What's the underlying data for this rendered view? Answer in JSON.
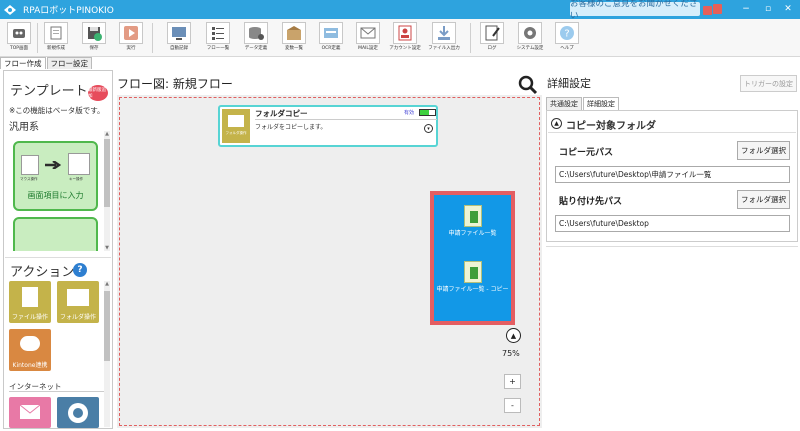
{
  "window": {
    "title": "RPAロボットPINOKIO",
    "feedback": "お客様のご意見をお聞かせください",
    "minimize": "−",
    "restore": "▫",
    "close": "✕"
  },
  "toolbar": {
    "items": [
      {
        "label": "TOP画面",
        "icon": "robot-icon"
      },
      {
        "label": "新規作成",
        "icon": "new-flow-icon"
      },
      {
        "label": "保存",
        "icon": "save-icon"
      },
      {
        "label": "実行",
        "icon": "play-icon"
      },
      {
        "label": "自動記録",
        "icon": "record-icon"
      },
      {
        "label": "フロー一覧",
        "icon": "flow-list-icon"
      },
      {
        "label": "データ定義",
        "icon": "data-definition-icon"
      },
      {
        "label": "変数一覧",
        "icon": "variable-list-icon"
      },
      {
        "label": "OCR定義",
        "icon": "ocr-icon"
      },
      {
        "label": "MAIL設定",
        "icon": "mail-settings-icon"
      },
      {
        "label": "アカウント設定",
        "icon": "account-icon"
      },
      {
        "label": "ファイル入出力",
        "icon": "file-io-icon"
      },
      {
        "label": "ログ",
        "icon": "log-icon"
      },
      {
        "label": "システム設定",
        "icon": "gear-icon"
      },
      {
        "label": "ヘルプ",
        "icon": "help-icon"
      }
    ]
  },
  "tabs": [
    "フロー作成",
    "フロー設定"
  ],
  "templates": {
    "title": "テンプレート",
    "badge": "最新版追加",
    "note": "※この機能はベータ版です。",
    "category": "汎用系",
    "card1": {
      "label": "画面項目に入力",
      "mini1": "マウス操作",
      "mini2": "キー操作"
    }
  },
  "actions": {
    "title": "アクション",
    "help": "?",
    "tiles": [
      {
        "label": "ファイル操作",
        "color": "#c4b34a"
      },
      {
        "label": "フォルダ操作",
        "color": "#c4b34a"
      },
      {
        "label": "Kintone連携",
        "color": "#d98841"
      }
    ],
    "category_internet": "インターネット"
  },
  "flow": {
    "title": "フロー図:  新規フロー",
    "node": {
      "icon_label": "フォルダ操作",
      "title": "フォルダコピー",
      "status": "有効",
      "description": "フォルダをコピーします。"
    },
    "files": [
      {
        "name": "申請ファイル一覧"
      },
      {
        "name": "申請ファイル一覧 - コピー"
      }
    ],
    "zoom": {
      "level": "75%",
      "plus": "+",
      "minus": "-"
    }
  },
  "details": {
    "title": "詳細設定",
    "trigger_button": "トリガーの設定",
    "tabs": [
      "共通設定",
      "詳細設定"
    ],
    "section_title": "コピー対象フォルダ",
    "source_label": "コピー元パス",
    "source_button": "フォルダ選択",
    "source_value": "C:\\Users\\future\\Desktop\\申請ファイル一覧",
    "dest_label": "貼り付け先パス",
    "dest_button": "フォルダ選択",
    "dest_value": "C:\\Users\\future\\Desktop"
  }
}
